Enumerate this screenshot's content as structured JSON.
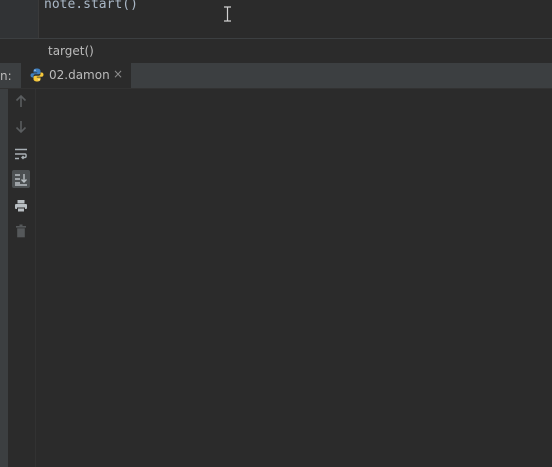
{
  "editor": {
    "code_line": "note.start()"
  },
  "breadcrumb": {
    "label": "target()"
  },
  "run_panel": {
    "label": "n:",
    "tab": {
      "label": "02.damon",
      "close": "×"
    }
  },
  "toolbar": {
    "icons": [
      "arrow-up-icon",
      "arrow-down-icon",
      "soft-wrap-icon",
      "scroll-to-end-icon",
      "print-icon",
      "trash-icon"
    ]
  },
  "colors": {
    "background": "#2b2b2b",
    "panel": "#3c3f41",
    "text": "#bbbbbb",
    "code": "#a9b7c6"
  }
}
